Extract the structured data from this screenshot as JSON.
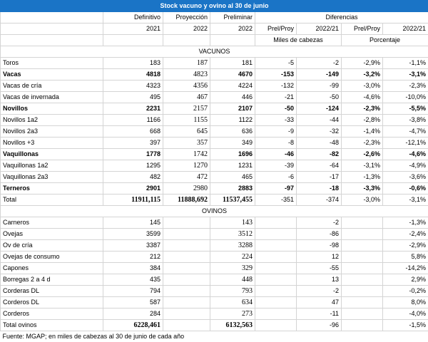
{
  "title": "Stock vacuno y ovino al 30 de junio",
  "headers": {
    "definitivo": "Definitivo",
    "proyeccion": "Proyección",
    "preliminar": "Preliminar",
    "diferencias": "Diferencias",
    "y2021": "2021",
    "y2022a": "2022",
    "y2022b": "2022",
    "prel_proy_1": "Prel/Proy",
    "y2022_21_1": "2022/21",
    "prel_proy_2": "Prel/Proy",
    "y2022_21_2": "2022/21",
    "miles": "Miles de cabezas",
    "porcentaje": "Porcentaje"
  },
  "sections": {
    "vacunos": "VACUNOS",
    "ovinos": "OVINOS"
  },
  "vacunos_rows": [
    {
      "label": "Toros",
      "def": "183",
      "proy": "187",
      "prel": "181",
      "d1": "-5",
      "d2": "-2",
      "p1": "-2,9%",
      "p2": "-1,1%",
      "style": "normal"
    },
    {
      "label": "Vacas",
      "def": "4818",
      "proy": "4823",
      "prel": "4670",
      "d1": "-153",
      "d2": "-149",
      "p1": "-3,2%",
      "p2": "-3,1%",
      "style": "bold"
    },
    {
      "label": "Vacas de cría",
      "def": "4323",
      "proy": "4356",
      "prel": "4224",
      "d1": "-132",
      "d2": "-99",
      "p1": "-3,0%",
      "p2": "-2,3%",
      "style": "normal"
    },
    {
      "label": "Vacas de invernada",
      "def": "495",
      "proy": "467",
      "prel": "446",
      "d1": "-21",
      "d2": "-50",
      "p1": "-4,6%",
      "p2": "-10,0%",
      "style": "normal"
    },
    {
      "label": "Novillos",
      "def": "2231",
      "proy": "2157",
      "prel": "2107",
      "d1": "-50",
      "d2": "-124",
      "p1": "-2,3%",
      "p2": "-5,5%",
      "style": "bold"
    },
    {
      "label": "Novillos 1a2",
      "def": "1166",
      "proy": "1155",
      "prel": "1122",
      "d1": "-33",
      "d2": "-44",
      "p1": "-2,8%",
      "p2": "-3,8%",
      "style": "normal"
    },
    {
      "label": "Novillos 2a3",
      "def": "668",
      "proy": "645",
      "prel": "636",
      "d1": "-9",
      "d2": "-32",
      "p1": "-1,4%",
      "p2": "-4,7%",
      "style": "normal"
    },
    {
      "label": "Novillos +3",
      "def": "397",
      "proy": "357",
      "prel": "349",
      "d1": "-8",
      "d2": "-48",
      "p1": "-2,3%",
      "p2": "-12,1%",
      "style": "normal"
    },
    {
      "label": "Vaquillonas",
      "def": "1778",
      "proy": "1742",
      "prel": "1696",
      "d1": "-46",
      "d2": "-82",
      "p1": "-2,6%",
      "p2": "-4,6%",
      "style": "bold"
    },
    {
      "label": "Vaquillonas 1a2",
      "def": "1295",
      "proy": "1270",
      "prel": "1231",
      "d1": "-39",
      "d2": "-64",
      "p1": "-3,1%",
      "p2": "-4,9%",
      "style": "normal"
    },
    {
      "label": "Vaquillonas 2a3",
      "def": "482",
      "proy": "472",
      "prel": "465",
      "d1": "-6",
      "d2": "-17",
      "p1": "-1,3%",
      "p2": "-3,6%",
      "style": "normal"
    },
    {
      "label": "Terneros",
      "def": "2901",
      "proy": "2980",
      "prel": "2883",
      "d1": "-97",
      "d2": "-18",
      "p1": "-3,3%",
      "p2": "-0,6%",
      "style": "bold"
    },
    {
      "label": "Total",
      "def": "11911,115",
      "proy": "11888,692",
      "prel": "11537,455",
      "d1": "-351",
      "d2": "-374",
      "p1": "-3,0%",
      "p2": "-3,1%",
      "style": "total"
    }
  ],
  "ovinos_rows": [
    {
      "label": "Carneros",
      "def": "145",
      "proy": "",
      "prel": "143",
      "d1": "",
      "d2": "-2",
      "p1": "",
      "p2": "-1,3%"
    },
    {
      "label": "Ovejas",
      "def": "3599",
      "proy": "",
      "prel": "3512",
      "d1": "",
      "d2": "-86",
      "p1": "",
      "p2": "-2,4%"
    },
    {
      "label": "Ov de cría",
      "def": "3387",
      "proy": "",
      "prel": "3288",
      "d1": "",
      "d2": "-98",
      "p1": "",
      "p2": "-2,9%"
    },
    {
      "label": "Ovejas de consumo",
      "def": "212",
      "proy": "",
      "prel": "224",
      "d1": "",
      "d2": "12",
      "p1": "",
      "p2": "5,8%"
    },
    {
      "label": "Capones",
      "def": "384",
      "proy": "",
      "prel": "329",
      "d1": "",
      "d2": "-55",
      "p1": "",
      "p2": "-14,2%"
    },
    {
      "label": "Borregas 2 a 4 d",
      "def": "435",
      "proy": "",
      "prel": "448",
      "d1": "",
      "d2": "13",
      "p1": "",
      "p2": "2,9%"
    },
    {
      "label": "Corderas DL",
      "def": "794",
      "proy": "",
      "prel": "793",
      "d1": "",
      "d2": "-2",
      "p1": "",
      "p2": "-0,2%"
    },
    {
      "label": "Corderos DL",
      "def": "587",
      "proy": "",
      "prel": "634",
      "d1": "",
      "d2": "47",
      "p1": "",
      "p2": "8,0%"
    },
    {
      "label": "Corderos",
      "def": "284",
      "proy": "",
      "prel": "273",
      "d1": "",
      "d2": "-11",
      "p1": "",
      "p2": "-4,0%"
    },
    {
      "label": "Total ovinos",
      "def": "6228,461",
      "proy": "",
      "prel": "6132,563",
      "d1": "",
      "d2": "-96",
      "p1": "",
      "p2": "-1,5%",
      "style": "total"
    }
  ],
  "source": "Fuente: MGAP; en miles de cabezas al 30 de junio de cada año"
}
